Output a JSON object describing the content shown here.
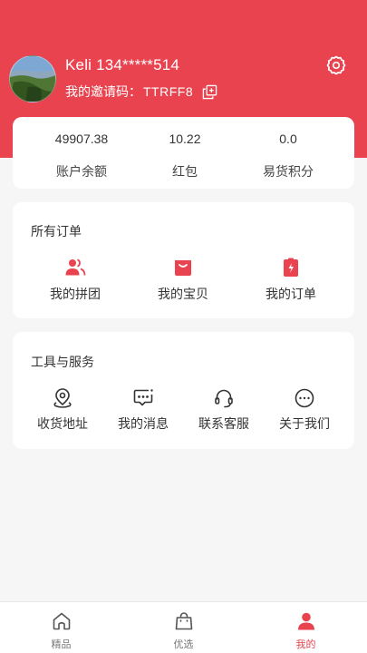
{
  "user": {
    "name": "Keli 134*****514",
    "invite_label": "我的邀请码：",
    "invite_code": "TTRFF8"
  },
  "balances": [
    {
      "value": "49907.38",
      "label": "账户余额"
    },
    {
      "value": "10.22",
      "label": "红包"
    },
    {
      "value": "0.0",
      "label": "易货积分"
    }
  ],
  "orders": {
    "title": "所有订单",
    "items": [
      {
        "label": "我的拼团",
        "icon": "group-icon"
      },
      {
        "label": "我的宝贝",
        "icon": "shopping-bag-icon"
      },
      {
        "label": "我的订单",
        "icon": "order-clipboard-icon"
      }
    ]
  },
  "tools": {
    "title": "工具与服务",
    "items": [
      {
        "label": "收货地址",
        "icon": "location-pin-icon"
      },
      {
        "label": "我的消息",
        "icon": "message-icon"
      },
      {
        "label": "联系客服",
        "icon": "headset-icon"
      },
      {
        "label": "关于我们",
        "icon": "more-dots-icon"
      }
    ]
  },
  "tabs": [
    {
      "label": "精品",
      "icon": "home-icon",
      "active": false
    },
    {
      "label": "优选",
      "icon": "bag-icon",
      "active": false
    },
    {
      "label": "我的",
      "icon": "user-icon",
      "active": true
    }
  ],
  "colors": {
    "accent": "#e9434f",
    "background": "#f6f6f6",
    "card": "#ffffff"
  }
}
